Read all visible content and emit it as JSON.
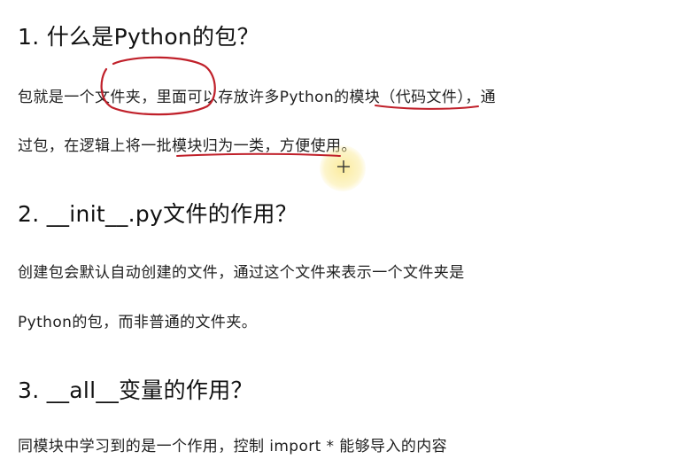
{
  "sections": [
    {
      "heading": "1. 什么是Python的包？",
      "lines": [
        "包就是一个文件夹，里面可以存放许多Python的模块（代码文件），通",
        "过包，在逻辑上将一批模块归为一类，方便使用。"
      ]
    },
    {
      "heading": "2. __init__.py文件的作用？",
      "lines": [
        "创建包会默认自动创建的文件，通过这个文件来表示一个文件夹是",
        "Python的包，而非普通的文件夹。"
      ]
    },
    {
      "heading": "3. __all__变量的作用？",
      "lines": [
        "同模块中学习到的是一个作用，控制 import * 能够导入的内容"
      ]
    }
  ],
  "colors": {
    "annotation": "#c0202a",
    "pointer_highlight": "#f7e58a"
  }
}
